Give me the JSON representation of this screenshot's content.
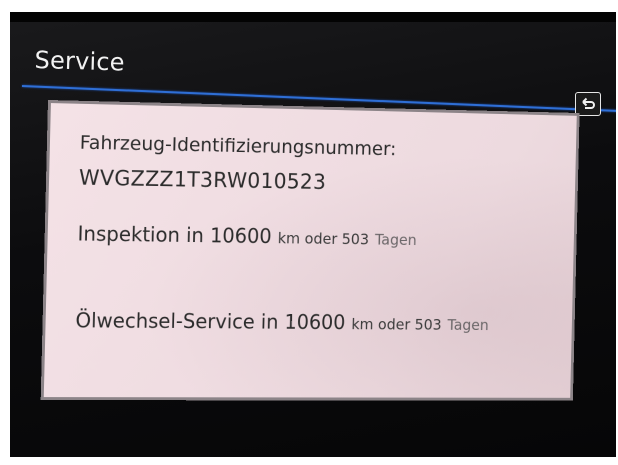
{
  "header": {
    "title": "Service"
  },
  "back_button": {
    "icon": "back-arrow-icon"
  },
  "vehicle": {
    "vin_label": "Fahrzeug-Identifizierungsnummer:",
    "vin": "WVGZZZ1T3RW010523"
  },
  "inspection": {
    "prefix": "Inspektion in 10600",
    "km_unit": "km oder 503",
    "days": "Tagen"
  },
  "oil_service": {
    "prefix": "Ölwechsel-Service in 10600",
    "km_unit": "km oder 503",
    "days": "Tagen"
  },
  "colors": {
    "accent_line": "#2f6fd6",
    "panel_background": "#f0dde2",
    "screen_background": "#0c0c0e"
  }
}
